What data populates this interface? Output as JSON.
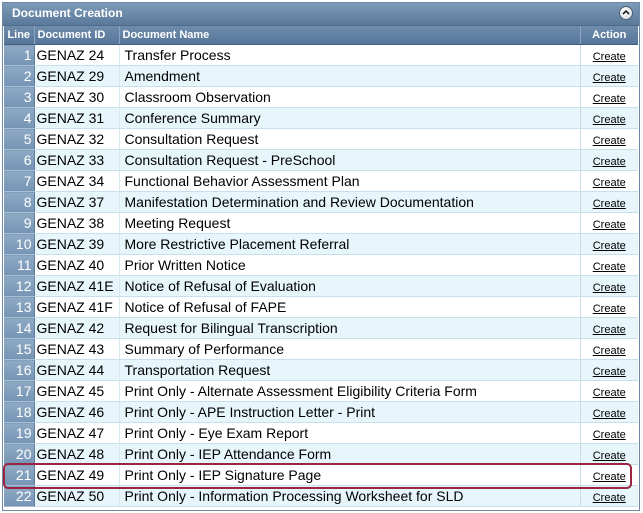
{
  "panel": {
    "title": "Document Creation",
    "collapse_icon": "collapse-up-icon"
  },
  "columns": {
    "line": "Line",
    "document_id": "Document ID",
    "document_name": "Document Name",
    "action": "Action"
  },
  "rows": [
    {
      "line": "1",
      "id": "GENAZ 24",
      "name": "Transfer Process",
      "action": "Create"
    },
    {
      "line": "2",
      "id": "GENAZ 29",
      "name": "Amendment",
      "action": "Create"
    },
    {
      "line": "3",
      "id": "GENAZ 30",
      "name": "Classroom Observation",
      "action": "Create"
    },
    {
      "line": "4",
      "id": "GENAZ 31",
      "name": "Conference Summary",
      "action": "Create"
    },
    {
      "line": "5",
      "id": "GENAZ 32",
      "name": "Consultation Request",
      "action": "Create"
    },
    {
      "line": "6",
      "id": "GENAZ 33",
      "name": "Consultation Request - PreSchool",
      "action": "Create"
    },
    {
      "line": "7",
      "id": "GENAZ 34",
      "name": "Functional Behavior Assessment Plan",
      "action": "Create"
    },
    {
      "line": "8",
      "id": "GENAZ 37",
      "name": "Manifestation Determination and Review Documentation",
      "action": "Create"
    },
    {
      "line": "9",
      "id": "GENAZ 38",
      "name": "Meeting Request",
      "action": "Create"
    },
    {
      "line": "10",
      "id": "GENAZ 39",
      "name": "More Restrictive Placement Referral",
      "action": "Create"
    },
    {
      "line": "11",
      "id": "GENAZ 40",
      "name": "Prior Written Notice",
      "action": "Create"
    },
    {
      "line": "12",
      "id": "GENAZ 41E",
      "name": "Notice of Refusal of Evaluation",
      "action": "Create"
    },
    {
      "line": "13",
      "id": "GENAZ 41F",
      "name": "Notice of Refusal of FAPE",
      "action": "Create"
    },
    {
      "line": "14",
      "id": "GENAZ 42",
      "name": "Request for Bilingual Transcription",
      "action": "Create"
    },
    {
      "line": "15",
      "id": "GENAZ 43",
      "name": "Summary of Performance",
      "action": "Create"
    },
    {
      "line": "16",
      "id": "GENAZ 44",
      "name": "Transportation Request",
      "action": "Create"
    },
    {
      "line": "17",
      "id": "GENAZ 45",
      "name": "Print Only - Alternate Assessment Eligibility Criteria Form",
      "action": "Create"
    },
    {
      "line": "18",
      "id": "GENAZ 46",
      "name": "Print Only - APE Instruction Letter - Print",
      "action": "Create"
    },
    {
      "line": "19",
      "id": "GENAZ 47",
      "name": "Print Only - Eye Exam Report",
      "action": "Create"
    },
    {
      "line": "20",
      "id": "GENAZ 48",
      "name": "Print Only - IEP Attendance Form",
      "action": "Create"
    },
    {
      "line": "21",
      "id": "GENAZ 49",
      "name": "Print Only - IEP Signature Page",
      "action": "Create"
    },
    {
      "line": "22",
      "id": "GENAZ 50",
      "name": "Print Only - Information Processing Worksheet for SLD",
      "action": "Create"
    }
  ],
  "highlighted_line": "21",
  "colors": {
    "header": "#5a7899",
    "row_alt": "#e6f6fb",
    "highlight": "#9c2440"
  }
}
